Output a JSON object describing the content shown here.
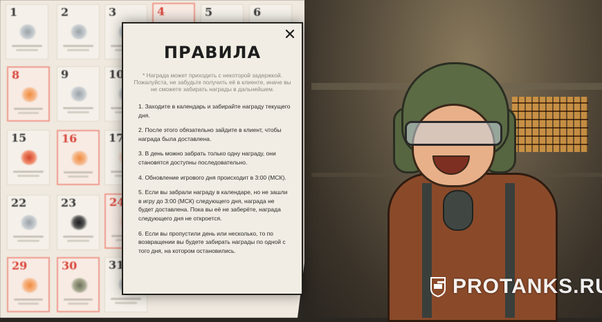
{
  "calendar": {
    "days": [
      {
        "n": "1",
        "special": false
      },
      {
        "n": "2",
        "special": false
      },
      {
        "n": "3",
        "special": false
      },
      {
        "n": "4",
        "special": true
      },
      {
        "n": "5",
        "special": false
      },
      {
        "n": "6",
        "special": false
      },
      {
        "n": "8",
        "special": true
      },
      {
        "n": "9",
        "special": false
      },
      {
        "n": "10",
        "special": false
      },
      {
        "n": "15",
        "special": false
      },
      {
        "n": "16",
        "special": true
      },
      {
        "n": "17",
        "special": false
      },
      {
        "n": "22",
        "special": false
      },
      {
        "n": "23",
        "special": false
      },
      {
        "n": "24",
        "special": true
      },
      {
        "n": "29",
        "special": true
      },
      {
        "n": "30",
        "special": true
      },
      {
        "n": "31",
        "special": false
      }
    ]
  },
  "modal": {
    "title": "ПРАВИЛА",
    "note": "* Награда может приходить с некоторой задержкой. Пожалуйста, не забудьте получить её в клиенте, иначе вы не сможете забирать награды в дальнейшем.",
    "rules": [
      "1. Заходите в календарь и забирайте награду текущего дня.",
      "2. После этого обязательно зайдите в клиент, чтобы награда была доставлена.",
      "3. В день можно забрать только одну награду, они становятся доступны последовательно.",
      "4. Обновление игрового дня происходит в 3:00 (МСК).",
      "5. Если вы забрали награду в календаре, но не зашли в игру до 3:00 (МСК) следующего дня, награда не будет доставлена. Пока вы её не заберёте, награда следующего дня не откроется.",
      "6. Если вы пропустили день или несколько, то по возвращении вы будете забирать награды по одной с того дня, на котором остановились."
    ]
  },
  "icons": {
    "close": "close-icon",
    "watermark": "tank-logo-icon"
  },
  "watermark": {
    "text": "PROTANKS.RU"
  }
}
